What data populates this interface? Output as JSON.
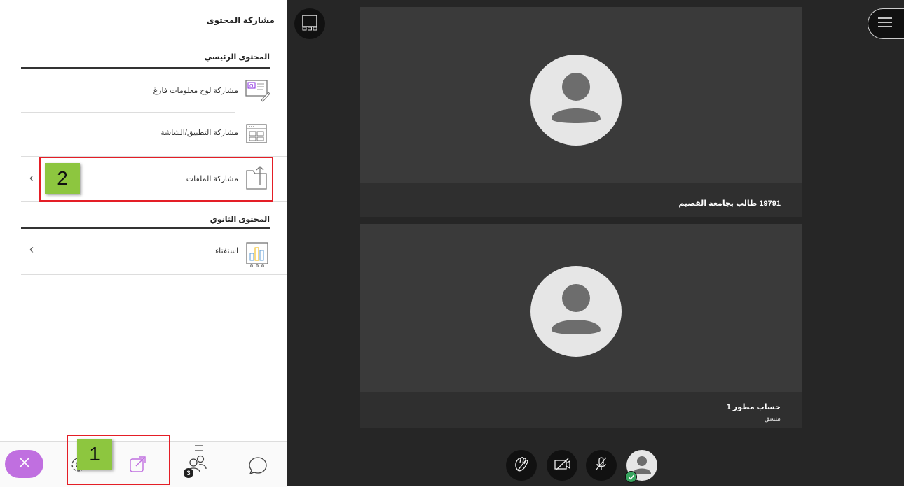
{
  "panel": {
    "title": "مشاركة المحتوى",
    "primary_section": "المحتوى الرئيسي",
    "secondary_section": "المحتوى الثانوي",
    "items": [
      {
        "label": "مشاركة لوح معلومات فارغ",
        "icon": "whiteboard-icon"
      },
      {
        "label": "مشاركة التطبيق/الشاشة",
        "icon": "application-window-icon"
      },
      {
        "label": "مشاركة الملفات",
        "icon": "file-share-icon"
      }
    ],
    "secondary_items": [
      {
        "label": "استفتاء",
        "icon": "poll-chart-icon"
      }
    ]
  },
  "footer": {
    "participants_count": "3",
    "icons": [
      "close-icon",
      "settings-icon",
      "share-content-icon",
      "participants-icon",
      "chat-icon"
    ]
  },
  "callouts": {
    "step1": "1",
    "step2": "2"
  },
  "stage": {
    "tiles": [
      {
        "name": "19791 طالب بجامعة القصيم",
        "role": ""
      },
      {
        "name": "حساب مطور 1",
        "role": "منسق"
      }
    ]
  },
  "colors": {
    "accent_purple": "#c06fe0",
    "callout_red": "#e41e26",
    "badge_green": "#8dc63f",
    "stage_bg": "#262626"
  }
}
